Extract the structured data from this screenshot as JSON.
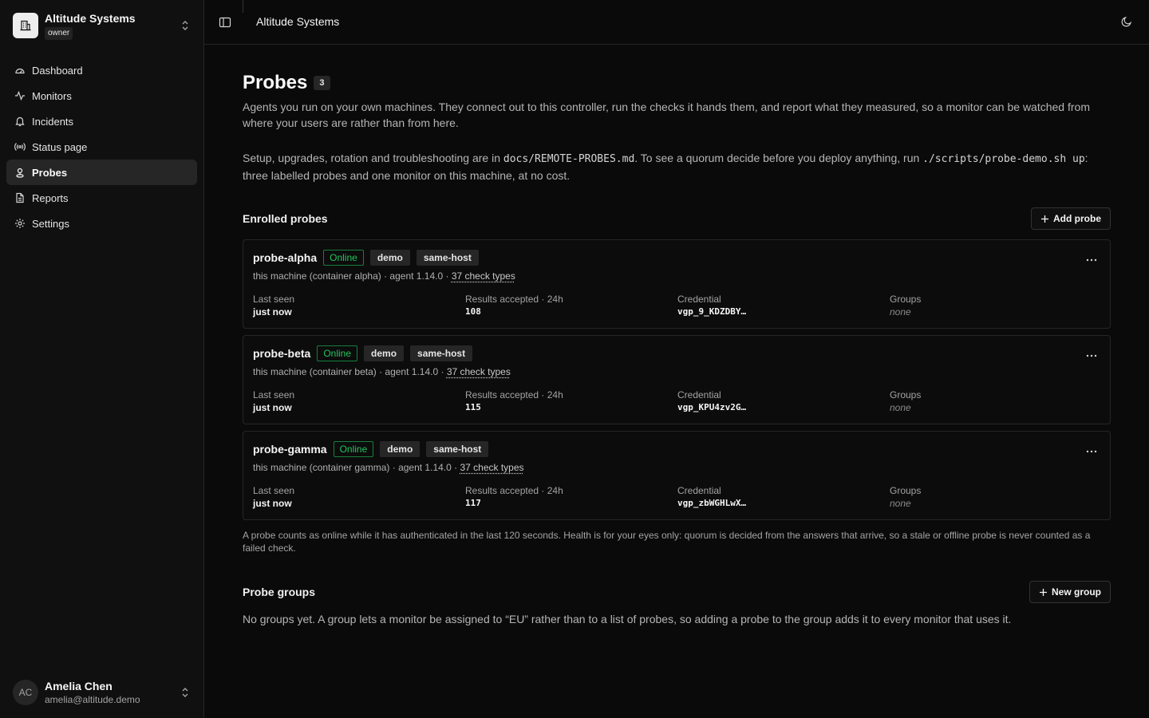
{
  "org": {
    "name": "Altitude Systems",
    "role": "owner"
  },
  "nav": [
    {
      "label": "Dashboard",
      "icon": "gauge-icon"
    },
    {
      "label": "Monitors",
      "icon": "activity-icon"
    },
    {
      "label": "Incidents",
      "icon": "bell-icon"
    },
    {
      "label": "Status page",
      "icon": "radio-icon"
    },
    {
      "label": "Probes",
      "icon": "map-pin-icon",
      "active": true
    },
    {
      "label": "Reports",
      "icon": "file-icon"
    },
    {
      "label": "Settings",
      "icon": "gear-icon"
    }
  ],
  "user": {
    "initials": "AC",
    "name": "Amelia Chen",
    "email": "amelia@altitude.demo"
  },
  "header": {
    "title": "Altitude Systems"
  },
  "page": {
    "title": "Probes",
    "count": "3",
    "intro": "Agents you run on your own machines. They connect out to this controller, run the checks it hands them, and report what they measured, so a monitor can be watched from where your users are rather than from here.",
    "setup_prefix": "Setup, upgrades, rotation and troubleshooting are in ",
    "setup_doc": "docs/REMOTE-PROBES.md",
    "setup_middle": ". To see a quorum decide before you deploy anything, run ",
    "setup_script": "./scripts/probe-demo.sh up",
    "setup_suffix": ": three labelled probes and one monitor on this machine, at no cost."
  },
  "enrolled": {
    "title": "Enrolled probes",
    "add_button": "Add probe",
    "stat_labels": {
      "last_seen": "Last seen",
      "results": "Results accepted · 24h",
      "credential": "Credential",
      "groups": "Groups"
    },
    "probes": [
      {
        "name": "probe-alpha",
        "status": "Online",
        "tags": [
          "demo",
          "same-host"
        ],
        "meta": "this machine (container alpha) · agent 1.14.0 · ",
        "check_types": "37 check types",
        "last_seen": "just now",
        "results": "108",
        "credential": "vgp_9_KDZDBY…",
        "groups": "none"
      },
      {
        "name": "probe-beta",
        "status": "Online",
        "tags": [
          "demo",
          "same-host"
        ],
        "meta": "this machine (container beta) · agent 1.14.0 · ",
        "check_types": "37 check types",
        "last_seen": "just now",
        "results": "115",
        "credential": "vgp_KPU4zv2G…",
        "groups": "none"
      },
      {
        "name": "probe-gamma",
        "status": "Online",
        "tags": [
          "demo",
          "same-host"
        ],
        "meta": "this machine (container gamma) · agent 1.14.0 · ",
        "check_types": "37 check types",
        "last_seen": "just now",
        "results": "117",
        "credential": "vgp_zbWGHLwX…",
        "groups": "none"
      }
    ],
    "footnote": "A probe counts as online while it has authenticated in the last 120 seconds. Health is for your eyes only: quorum is decided from the answers that arrive, so a stale or offline probe is never counted as a failed check."
  },
  "groups": {
    "title": "Probe groups",
    "new_button": "New group",
    "empty": "No groups yet. A group lets a monitor be assigned to “EU” rather than to a list of probes, so adding a probe to the group adds it to every monitor that uses it."
  },
  "colors": {
    "online": "#22c55e",
    "background": "#0a0a0a",
    "sidebar": "#101010"
  }
}
